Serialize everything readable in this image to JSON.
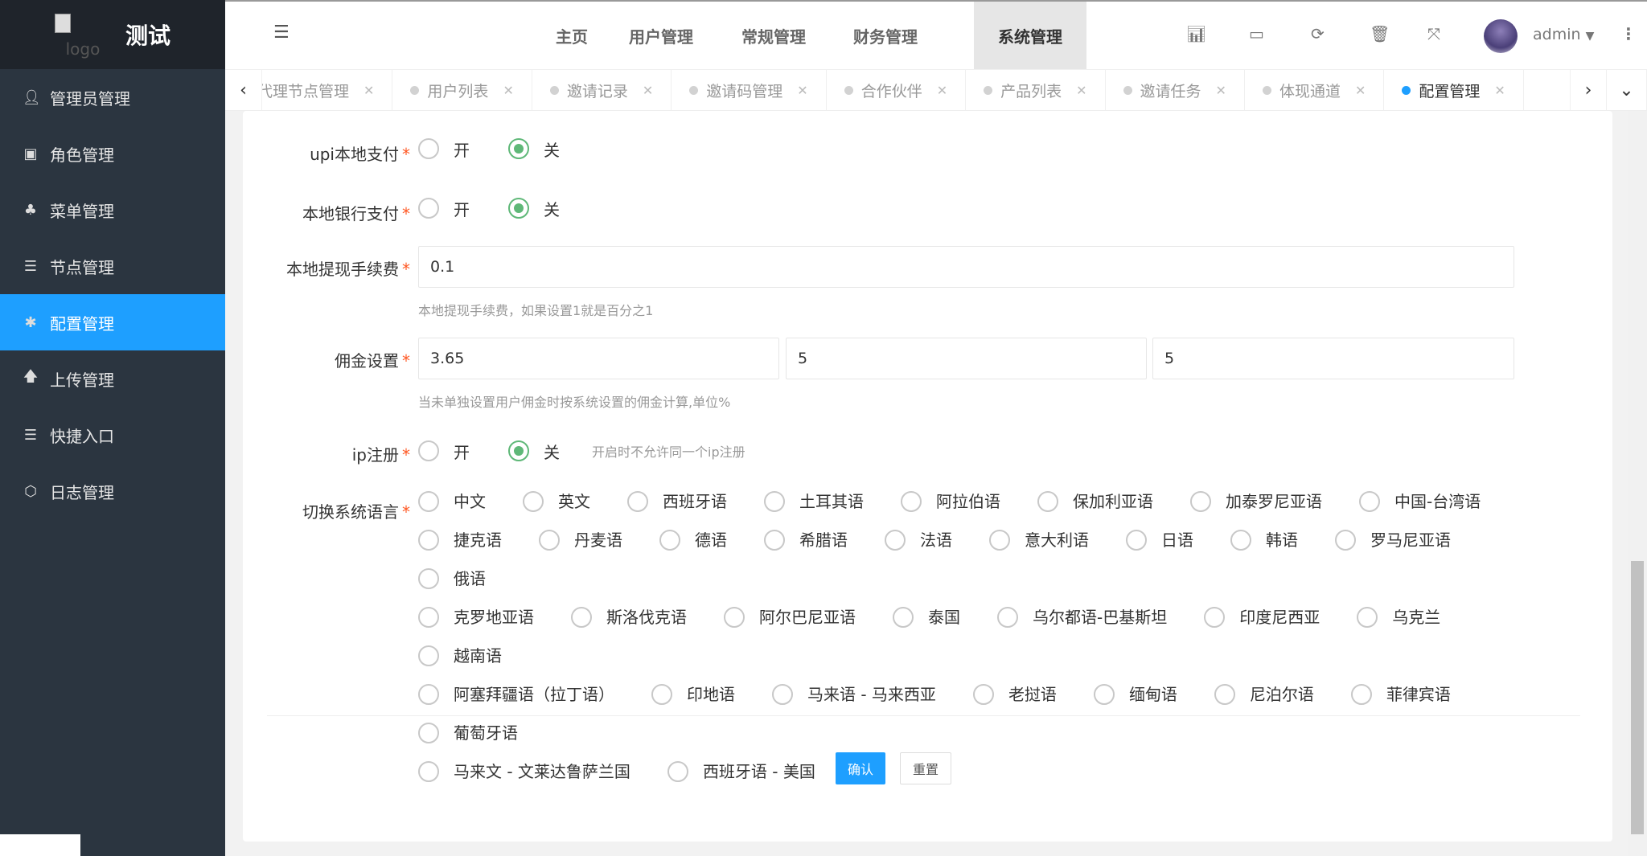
{
  "app": {
    "title": "测试",
    "logo_alt": "logo"
  },
  "sidebar": {
    "items": [
      {
        "label": "管理员管理",
        "icon": "user-icon"
      },
      {
        "label": "角色管理",
        "icon": "role-icon"
      },
      {
        "label": "菜单管理",
        "icon": "tree-icon"
      },
      {
        "label": "节点管理",
        "icon": "list-icon"
      },
      {
        "label": "配置管理",
        "icon": "gear-icon",
        "active": true
      },
      {
        "label": "上传管理",
        "icon": "upload-icon"
      },
      {
        "label": "快捷入口",
        "icon": "list-icon"
      },
      {
        "label": "日志管理",
        "icon": "log-icon"
      }
    ]
  },
  "header": {
    "nav": [
      "主页",
      "用户管理",
      "常规管理",
      "财务管理",
      "系统管理"
    ],
    "active_nav": "系统管理",
    "user": "admin",
    "icons": [
      "chart-icon",
      "card-icon",
      "refresh-icon",
      "trash-icon",
      "fullscreen-icon"
    ]
  },
  "tabs": [
    {
      "label": "代理节点管理"
    },
    {
      "label": "用户列表"
    },
    {
      "label": "邀请记录"
    },
    {
      "label": "邀请码管理"
    },
    {
      "label": "合作伙伴"
    },
    {
      "label": "产品列表"
    },
    {
      "label": "邀请任务"
    },
    {
      "label": "体现通道"
    },
    {
      "label": "配置管理",
      "active": true
    }
  ],
  "form": {
    "upi": {
      "label": "upi本地支付",
      "on": "开",
      "off": "关",
      "value": "关"
    },
    "bank": {
      "label": "本地银行支付",
      "on": "开",
      "off": "关",
      "value": "关"
    },
    "fee": {
      "label": "本地提现手续费",
      "value": "0.1",
      "help": "本地提现手续费，如果设置1就是百分之1"
    },
    "commission": {
      "label": "佣金设置",
      "values": [
        "3.65",
        "5",
        "5"
      ],
      "help": "当未单独设置用户佣金时按系统设置的佣金计算,单位%"
    },
    "ip": {
      "label": "ip注册",
      "on": "开",
      "off": "关",
      "value": "关",
      "help": "开启时不允许同一个ip注册"
    },
    "lang": {
      "label": "切换系统语言",
      "options": [
        "中文",
        "英文",
        "西班牙语",
        "土耳其语",
        "阿拉伯语",
        "保加利亚语",
        "加泰罗尼亚语",
        "中国-台湾语",
        "捷克语",
        "丹麦语",
        "德语",
        "希腊语",
        "法语",
        "意大利语",
        "日语",
        "韩语",
        "罗马尼亚语",
        "俄语",
        "克罗地亚语",
        "斯洛伐克语",
        "阿尔巴尼亚语",
        "泰国",
        "乌尔都语-巴基斯坦",
        "印度尼西亚",
        "乌克兰",
        "越南语",
        "阿塞拜疆语（拉丁语）",
        "印地语",
        "马来语 - 马来西亚",
        "老挝语",
        "缅甸语",
        "尼泊尔语",
        "菲律宾语",
        "葡萄牙语",
        "马来文 - 文莱达鲁萨兰国",
        "西班牙语 - 美国"
      ],
      "value": null
    },
    "submit": "确认",
    "reset": "重置"
  },
  "colors": {
    "accent": "#1e9fff",
    "radio_checked": "#5fb878",
    "sidebar": "#2b3540"
  }
}
